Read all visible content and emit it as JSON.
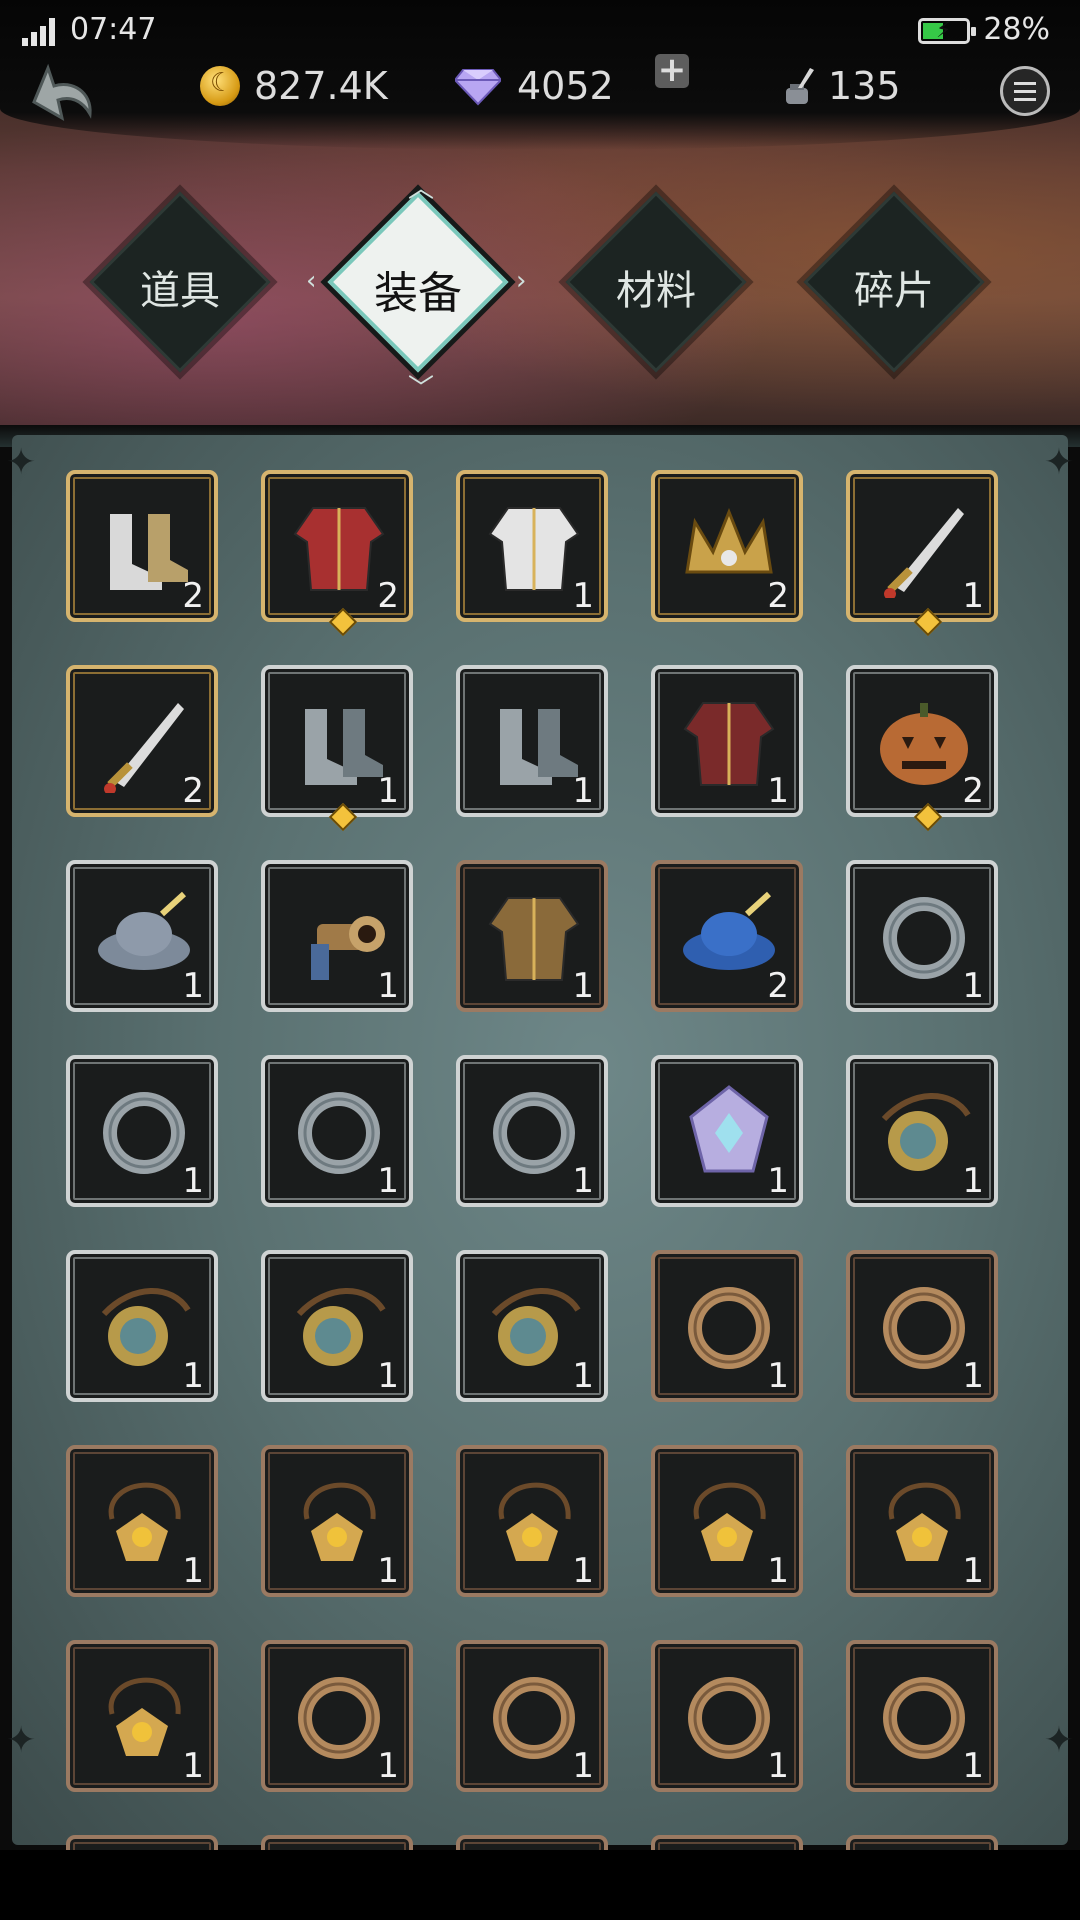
{
  "status_bar": {
    "time": "07:47",
    "battery": "28%"
  },
  "currencies": {
    "gold": "827.4K",
    "gems": "4052",
    "ink": "135"
  },
  "tabs": [
    {
      "label": "道具",
      "active": false
    },
    {
      "label": "装备",
      "active": true
    },
    {
      "label": "材料",
      "active": false
    },
    {
      "label": "碎片",
      "active": false
    }
  ],
  "items": [
    {
      "name": "winged-boots",
      "qty": "2",
      "rarity": "gold",
      "marked": false
    },
    {
      "name": "red-uniform",
      "qty": "2",
      "rarity": "gold",
      "marked": true
    },
    {
      "name": "white-dress",
      "qty": "1",
      "rarity": "gold",
      "marked": false
    },
    {
      "name": "crown",
      "qty": "2",
      "rarity": "gold",
      "marked": false
    },
    {
      "name": "dagger",
      "qty": "1",
      "rarity": "gold",
      "marked": true
    },
    {
      "name": "curved-blade",
      "qty": "2",
      "rarity": "gold",
      "marked": false
    },
    {
      "name": "green-boots",
      "qty": "1",
      "rarity": "silver",
      "marked": true
    },
    {
      "name": "brown-shoes",
      "qty": "1",
      "rarity": "silver",
      "marked": false
    },
    {
      "name": "fur-coat",
      "qty": "1",
      "rarity": "silver",
      "marked": false
    },
    {
      "name": "pumpkin-head",
      "qty": "2",
      "rarity": "silver",
      "marked": true
    },
    {
      "name": "feathered-hat",
      "qty": "1",
      "rarity": "silver",
      "marked": false
    },
    {
      "name": "blunderbuss",
      "qty": "1",
      "rarity": "silver",
      "marked": false
    },
    {
      "name": "peasant-tunic",
      "qty": "1",
      "rarity": "bronze",
      "marked": false
    },
    {
      "name": "blue-beret",
      "qty": "2",
      "rarity": "bronze",
      "marked": false
    },
    {
      "name": "silver-ring",
      "qty": "1",
      "rarity": "silver",
      "marked": false
    },
    {
      "name": "silver-ring",
      "qty": "1",
      "rarity": "silver",
      "marked": false
    },
    {
      "name": "earrings",
      "qty": "1",
      "rarity": "silver",
      "marked": false
    },
    {
      "name": "earrings",
      "qty": "1",
      "rarity": "silver",
      "marked": false
    },
    {
      "name": "crystal-brooch",
      "qty": "1",
      "rarity": "silver",
      "marked": false
    },
    {
      "name": "monocle",
      "qty": "1",
      "rarity": "silver",
      "marked": false
    },
    {
      "name": "monocle",
      "qty": "1",
      "rarity": "silver",
      "marked": false
    },
    {
      "name": "monocle",
      "qty": "1",
      "rarity": "silver",
      "marked": false
    },
    {
      "name": "monocle",
      "qty": "1",
      "rarity": "silver",
      "marked": false
    },
    {
      "name": "bronze-ring",
      "qty": "1",
      "rarity": "bronze",
      "marked": false
    },
    {
      "name": "bronze-ring",
      "qty": "1",
      "rarity": "bronze",
      "marked": false
    },
    {
      "name": "amulet",
      "qty": "1",
      "rarity": "bronze",
      "marked": false
    },
    {
      "name": "amulet",
      "qty": "1",
      "rarity": "bronze",
      "marked": false
    },
    {
      "name": "amulet",
      "qty": "1",
      "rarity": "bronze",
      "marked": false
    },
    {
      "name": "amulet",
      "qty": "1",
      "rarity": "bronze",
      "marked": false
    },
    {
      "name": "amulet",
      "qty": "1",
      "rarity": "bronze",
      "marked": false
    },
    {
      "name": "amulet",
      "qty": "1",
      "rarity": "bronze",
      "marked": false
    },
    {
      "name": "bronze-earrings",
      "qty": "1",
      "rarity": "bronze",
      "marked": false
    },
    {
      "name": "bronze-earrings",
      "qty": "1",
      "rarity": "bronze",
      "marked": false
    },
    {
      "name": "bronze-earrings",
      "qty": "1",
      "rarity": "bronze",
      "marked": false
    },
    {
      "name": "bronze-earrings",
      "qty": "1",
      "rarity": "bronze",
      "marked": false
    }
  ]
}
